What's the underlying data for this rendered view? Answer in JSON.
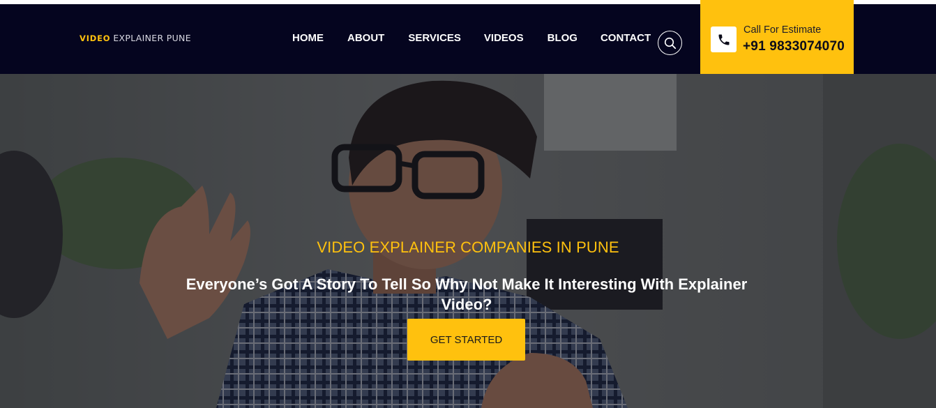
{
  "brand": {
    "bold": "VIDEO",
    "regular": "EXPLAINER PUNE"
  },
  "nav": {
    "items": [
      "HOME",
      "ABOUT",
      "SERVICES",
      "VIDEOS",
      "BLOG",
      "CONTACT"
    ]
  },
  "search": {
    "icon": "search-icon"
  },
  "estimate": {
    "label": "Call For Estimate",
    "phone": "+91 9833074070",
    "icon": "phone-icon"
  },
  "hero": {
    "subtitle": "VIDEO EXPLAINER COMPANIES IN PUNE",
    "title": "Everyone’s Got A Story To Tell So Why Not Make It Interesting With Explainer Video?",
    "cta": "GET STARTED"
  },
  "colors": {
    "navy": "#05051f",
    "accent": "#ffc10e",
    "accent_dark": "#f59b0a"
  }
}
